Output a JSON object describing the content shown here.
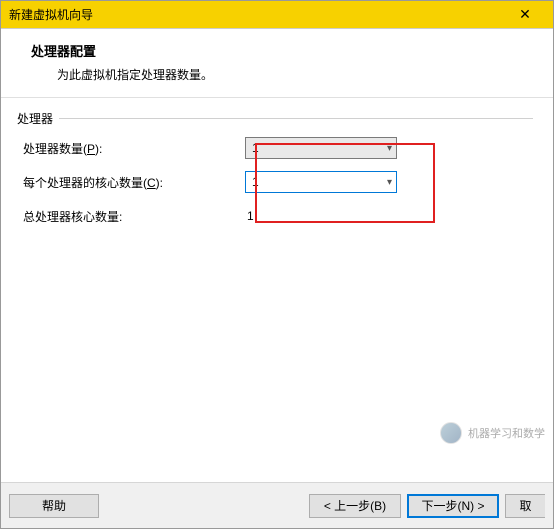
{
  "titlebar": {
    "title": "新建虚拟机向导"
  },
  "header": {
    "title": "处理器配置",
    "subtitle": "为此虚拟机指定处理器数量。"
  },
  "group": {
    "label": "处理器",
    "rows": {
      "proc_count": {
        "label_pre": "处理器数量(",
        "label_key": "P",
        "label_post": "):",
        "value": "1"
      },
      "cores_per": {
        "label_pre": "每个处理器的核心数量(",
        "label_key": "C",
        "label_post": "):",
        "value": "1"
      },
      "total": {
        "label": "总处理器核心数量:",
        "value": "1"
      }
    }
  },
  "footer": {
    "help": "帮助",
    "back": "< 上一步(B)",
    "next": "下一步(N) >",
    "cancel_partial": "取"
  },
  "watermark": {
    "text": "机器学习和数学"
  }
}
